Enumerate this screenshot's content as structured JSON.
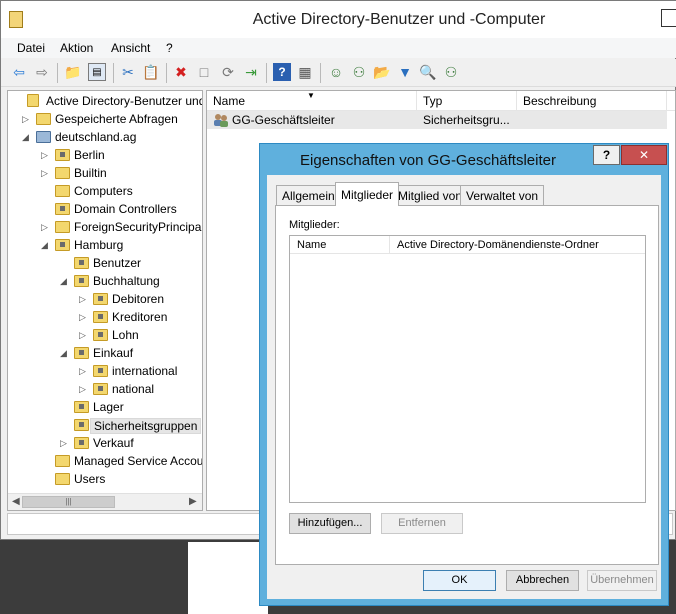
{
  "window": {
    "title": "Active Directory-Benutzer und -Computer"
  },
  "menu": [
    "Datei",
    "Aktion",
    "Ansicht",
    "?"
  ],
  "tree": {
    "items": [
      {
        "label": "Active Directory-Benutzer und -",
        "depth": 0,
        "expander": "",
        "icon": "console"
      },
      {
        "label": "Gespeicherte Abfragen",
        "depth": 1,
        "expander": "closed",
        "icon": "folder"
      },
      {
        "label": "deutschland.ag",
        "depth": 1,
        "expander": "open",
        "icon": "domain"
      },
      {
        "label": "Berlin",
        "depth": 2,
        "expander": "closed",
        "icon": "ou"
      },
      {
        "label": "Builtin",
        "depth": 2,
        "expander": "closed",
        "icon": "folder"
      },
      {
        "label": "Computers",
        "depth": 2,
        "expander": "",
        "icon": "folder"
      },
      {
        "label": "Domain Controllers",
        "depth": 2,
        "expander": "",
        "icon": "ou"
      },
      {
        "label": "ForeignSecurityPrincipals",
        "depth": 2,
        "expander": "closed",
        "icon": "folder"
      },
      {
        "label": "Hamburg",
        "depth": 2,
        "expander": "open",
        "icon": "ou"
      },
      {
        "label": "Benutzer",
        "depth": 3,
        "expander": "",
        "icon": "ou"
      },
      {
        "label": "Buchhaltung",
        "depth": 3,
        "expander": "open",
        "icon": "ou"
      },
      {
        "label": "Debitoren",
        "depth": 4,
        "expander": "closed",
        "icon": "ou"
      },
      {
        "label": "Kreditoren",
        "depth": 4,
        "expander": "closed",
        "icon": "ou"
      },
      {
        "label": "Lohn",
        "depth": 4,
        "expander": "closed",
        "icon": "ou"
      },
      {
        "label": "Einkauf",
        "depth": 3,
        "expander": "open",
        "icon": "ou"
      },
      {
        "label": "international",
        "depth": 4,
        "expander": "closed",
        "icon": "ou"
      },
      {
        "label": "national",
        "depth": 4,
        "expander": "closed",
        "icon": "ou"
      },
      {
        "label": "Lager",
        "depth": 3,
        "expander": "",
        "icon": "ou"
      },
      {
        "label": "Sicherheitsgruppen",
        "depth": 3,
        "expander": "",
        "icon": "ou",
        "selected": true
      },
      {
        "label": "Verkauf",
        "depth": 3,
        "expander": "closed",
        "icon": "ou"
      },
      {
        "label": "Managed Service Accour",
        "depth": 2,
        "expander": "",
        "icon": "folder"
      },
      {
        "label": "Users",
        "depth": 2,
        "expander": "",
        "icon": "folder"
      }
    ]
  },
  "list": {
    "columns": [
      "Name",
      "Typ",
      "Beschreibung"
    ],
    "rows": [
      {
        "name": "GG-Geschäftsleiter",
        "type": "Sicherheitsgru...",
        "description": ""
      }
    ]
  },
  "dialog": {
    "title": "Eigenschaften von GG-Geschäftsleiter",
    "help": "?",
    "close": "✕",
    "tabs": [
      "Allgemein",
      "Mitglieder",
      "Mitglied von",
      "Verwaltet von"
    ],
    "active_tab": "Mitglieder",
    "members_label": "Mitglieder:",
    "members_columns": [
      "Name",
      "Active Directory-Domänendienste-Ordner"
    ],
    "add_button": "Hinzufügen...",
    "remove_button": "Entfernen",
    "ok_button": "OK",
    "cancel_button": "Abbrechen",
    "apply_button": "Übernehmen"
  },
  "colors": {
    "dialog_frame": "#5fb0dd",
    "close_button": "#c75050",
    "folder": "#f3d76e"
  }
}
